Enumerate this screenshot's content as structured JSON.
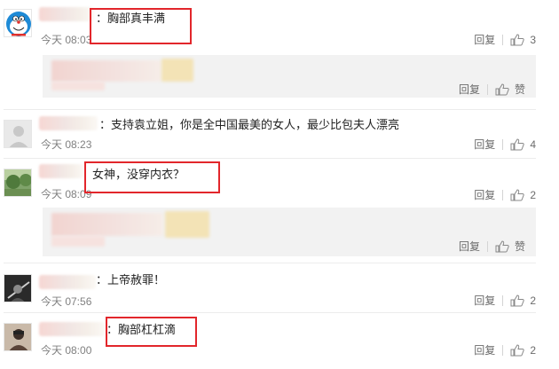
{
  "comments": [
    {
      "text": "：胸部真丰满",
      "time": "今天 08:03",
      "reply_label": "回复",
      "like_count": "3",
      "reply_box": {
        "reply_label": "回复",
        "like_label": "赞"
      }
    },
    {
      "text": "：支持袁立姐，你是全中国最美的女人，最少比包夫人漂亮",
      "time": "今天 08:23",
      "reply_label": "回复",
      "like_count": "4"
    },
    {
      "text": "女神，没穿内衣？",
      "time": "今天 08:09",
      "reply_label": "回复",
      "like_count": "2",
      "reply_box": {
        "reply_label": "回复",
        "like_label": "赞"
      }
    },
    {
      "text": "：上帝赦罪！",
      "time": "今天 07:56",
      "reply_label": "回复",
      "like_count": "2"
    },
    {
      "text": "：胸部杠杠滴",
      "time": "今天 08:00",
      "reply_label": "回复",
      "like_count": "2"
    }
  ],
  "icons": {
    "like": "thumbs-up-icon",
    "avatar_1": "cartoon-cat-avatar",
    "avatar_2": "default-user-avatar"
  },
  "colors": {
    "highlight_box": "#e2262b",
    "reply_box_bg": "#f2f2f2",
    "time_text": "#808080"
  }
}
